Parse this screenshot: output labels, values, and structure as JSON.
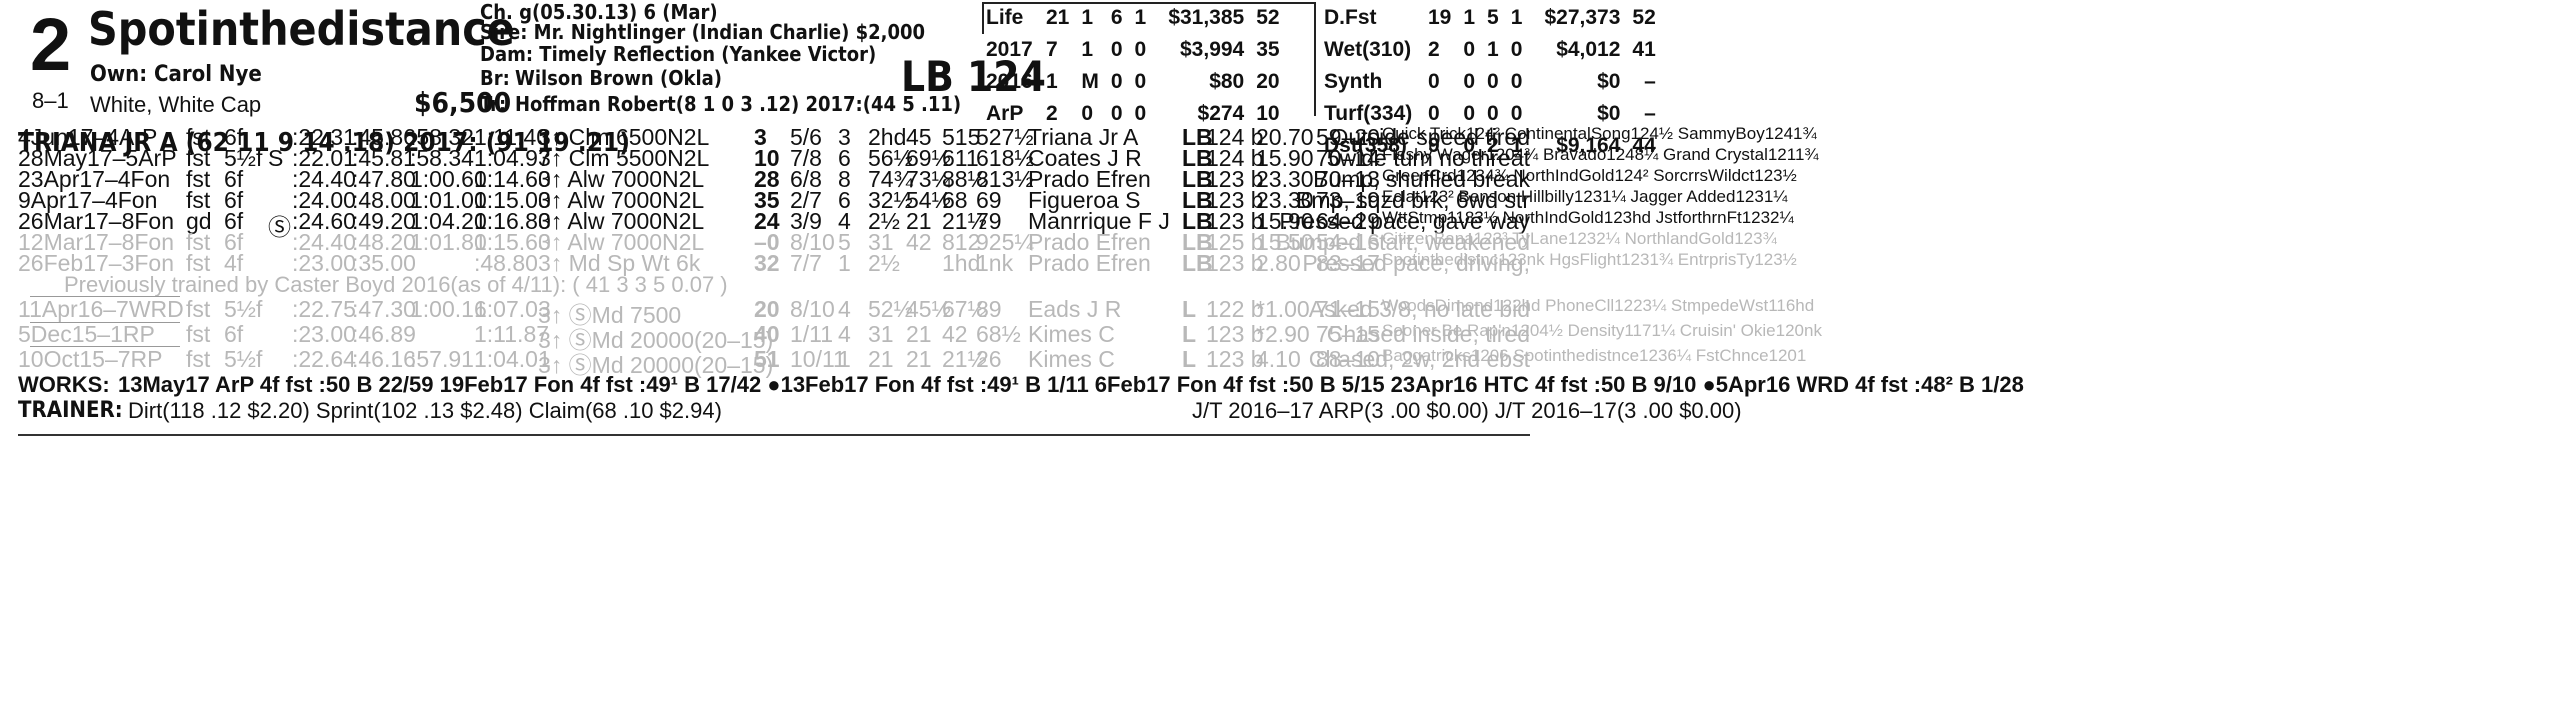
{
  "header": {
    "post_position": "2",
    "horse_name": "Spotinthedistance",
    "morning_line": "8–1",
    "owner": "Own: Carol Nye",
    "silks": "White, White Cap",
    "claim_price": "$6,500",
    "jockey_line": "TRIANA JR A (62 11 9 14 .18) 2017: (91 19 .21)",
    "sex_age": "Ch. g(05.30.13) 6 (Mar)",
    "sire": "Sire: Mr. Nightlinger (Indian Charlie) $2,000",
    "dam": "Dam: Timely Reflection (Yankee Victor)",
    "breeder_label": "Br:",
    "breeder": "Wilson Brown (Okla)",
    "trainer_label": "Tr:",
    "trainer": "Hoffman Robert(8 1 0 3 .12) 2017:(44 5 .11)",
    "weight": "LB 124"
  },
  "record_left": [
    [
      "Life",
      "21",
      "1",
      "6",
      "1",
      "$31,385",
      "52"
    ],
    [
      "2017",
      "7",
      "1",
      "0",
      "0",
      "$3,994",
      "35"
    ],
    [
      "2016",
      "1",
      "M",
      "0",
      "0",
      "$80",
      "20"
    ],
    [
      "ArP",
      "2",
      "0",
      "0",
      "0",
      "$274",
      "10"
    ]
  ],
  "record_right": [
    [
      "D.Fst",
      "19",
      "1",
      "5",
      "1",
      "$27,373",
      "52"
    ],
    [
      "Wet(310)",
      "2",
      "0",
      "1",
      "0",
      "$4,012",
      "41"
    ],
    [
      "Synth",
      "0",
      "0",
      "0",
      "0",
      "$0",
      "–"
    ],
    [
      "Turf(334)",
      "0",
      "0",
      "0",
      "0",
      "$0",
      "–"
    ],
    [
      "Dst(358)",
      "9",
      "0",
      "2",
      "1",
      "$9,164",
      "44"
    ]
  ],
  "past_performances": [
    {
      "date": "4Jun17–4ArP",
      "cond": "fst",
      "dist": "6f",
      "mark": "",
      "fr1": ":22.31",
      "fr2": ":45.86",
      "fr3": ":58.32",
      "fin": "1:11.40",
      "race": "3↑ Clm 6500N2L",
      "bsf": "3",
      "pp": "5/6",
      "st": "3",
      "c1": "2hd",
      "c2": "45",
      "str": "515",
      "finpos": "527½",
      "jockey": "Triana Jr A",
      "med": "LB",
      "wt": "124 b",
      "odds": "20.70",
      "figs": "59–20",
      "top3": "Quick Trick124² ContinentalSong124½ SammyBoy1241¾",
      "comment": "Outside speed tired",
      "faded": false
    },
    {
      "date": "28May17–5ArP",
      "cond": "fst",
      "dist": "5½f",
      "mark": "S",
      "fr1": ":22.01",
      "fr2": ":45.81",
      "fr3": ":58.34",
      "fin": "1:04.97",
      "race": "3↑ Clm 5500N2L",
      "bsf": "10",
      "pp": "7/8",
      "st": "6",
      "c1": "56½",
      "c2": "69½",
      "str": "611",
      "finpos": "618½",
      "jockey": "Coates J R",
      "med": "LB",
      "wt": "124 b",
      "odds": "15.90",
      "figs": "70–14",
      "top3": "Flashy Wager1204¾ Bravado1248¼ Grand Crystal1211¾",
      "comment": "5wide turn no threat",
      "faded": false
    },
    {
      "date": "23Apr17–4Fon",
      "cond": "fst",
      "dist": "6f",
      "mark": "",
      "fr1": ":24.40",
      "fr2": ":47.80",
      "fr3": "1:00.60",
      "fin": "1:14.60",
      "race": "3↑ Alw 7000N2L",
      "bsf": "28",
      "pp": "6/8",
      "st": "8",
      "c1": "74¾",
      "c2": "73¼",
      "str": "88½",
      "finpos": "813½",
      "jockey": "Prado Efren",
      "med": "LB",
      "wt": "123 b",
      "odds": "23.30",
      "figs": "70–13",
      "top3": "GreenCrd1234¾ NorthIndGold124² SorcrrsWildct123½",
      "comment": "Bump, shuffled break",
      "faded": false
    },
    {
      "date": "9Apr17–4Fon",
      "cond": "fst",
      "dist": "6f",
      "mark": "",
      "fr1": ":24.00",
      "fr2": ":48.00",
      "fr3": "1:01.00",
      "fin": "1:15.00",
      "race": "3↑ Alw 7000N2L",
      "bsf": "35",
      "pp": "2/7",
      "st": "6",
      "c1": "32½",
      "c2": "54½",
      "str": "68",
      "finpos": "69",
      "jockey": "Figueroa S",
      "med": "LB",
      "wt": "123 b",
      "odds": "23.30",
      "figs": "73–19",
      "top3": "Eclat123² Benson Hillbilly1231¼ Jagger Added1231¼",
      "comment": "Bmp, sqzd brk, 6wd str",
      "faded": false
    },
    {
      "date": "26Mar17–8Fon",
      "cond": "gd",
      "dist": "6f",
      "mark": "Ⓢ",
      "fr1": ":24.60",
      "fr2": ":49.20",
      "fr3": "1:04.20",
      "fin": "1:16.80",
      "race": "3↑ Alw 7000N2L",
      "bsf": "24",
      "pp": "3/9",
      "st": "4",
      "c1": "2½",
      "c2": "21",
      "str": "21½",
      "finpos": "79",
      "jockey": "Manrrique F J",
      "med": "LB",
      "wt": "123 b",
      "odds": "15.90",
      "figs": "64–29",
      "top3": "WttStmp1183½ NorthIndGold123hd JstforthrnFt1232¼",
      "comment": "Pressed pace, gave way",
      "faded": false
    },
    {
      "date": "12Mar17–8Fon",
      "cond": "fst",
      "dist": "6f",
      "mark": "",
      "fr1": ":24.40",
      "fr2": ":48.20",
      "fr3": "1:01.80",
      "fin": "1:15.60",
      "race": "3↑ Alw 7000N2L",
      "bsf": "–0",
      "pp": "8/10",
      "st": "5",
      "c1": "31",
      "c2": "42",
      "str": "812",
      "finpos": "925¼",
      "jockey": "Prado Efren",
      "med": "LB",
      "wt": "125 b",
      "odds": "15.50",
      "figs": "54–16",
      "top3": "CitizenBana123³ TyLane1232¼ NorthlandGold123¾",
      "comment": "Bumped start, weakened",
      "faded": true
    },
    {
      "date": "26Feb17–3Fon",
      "cond": "fst",
      "dist": "4f",
      "mark": "",
      "fr1": ":23.00",
      "fr2": ":35.00",
      "fr3": "",
      "fin": ":48.80",
      "race": "3↑ Md Sp Wt 6k",
      "bsf": "32",
      "pp": "7/7",
      "st": "1",
      "c1": "2½",
      "c2": "",
      "str": "1hd",
      "finpos": "1nk",
      "jockey": "Prado Efren",
      "med": "LB",
      "wt": "123 b",
      "odds": "2.80",
      "figs": "83–17",
      "top3": "Spotinthedistnc123nk HgsFlight1231¾ EntrprisTy123½",
      "comment": "Pressed pace, driving,",
      "faded": true
    }
  ],
  "previous_trainer_note": "Previously trained by Caster Boyd 2016(as of 4/11): ( 41 3 3 5 0.07 )",
  "older_performances": [
    {
      "date": "11Apr16–7WRD",
      "cond": "fst",
      "dist": "5½f",
      "mark": "",
      "fr1": ":22.75",
      "fr2": ":47.30",
      "fr3": "1:00.16",
      "fin": "1:07.03",
      "race": "3↑ ⓈMd 7500",
      "bsf": "20",
      "pp": "8/10",
      "st": "4",
      "c1": "52½",
      "c2": "45½",
      "str": "67½",
      "finpos": "89",
      "jockey": "Eads J R",
      "med": "L",
      "wt": "122 b",
      "odds": "*1.00",
      "figs": "71–15",
      "top3": "WoodsDimond122hd PhoneCll1223¼ StmpedeWst116hd",
      "comment": "Asked 3/8, no late bid"
    },
    {
      "date": "5Dec15–1RP",
      "cond": "fst",
      "dist": "6f",
      "mark": "",
      "fr1": ":23.00",
      "fr2": ":46.89",
      "fr3": "",
      "fin": "1:11.87",
      "race": "3↑ ⓈMd 20000(20–15)",
      "bsf": "40",
      "pp": "1/11",
      "st": "4",
      "c1": "31",
      "c2": "21",
      "str": "42",
      "finpos": "68½",
      "jockey": "Kimes C",
      "med": "L",
      "wt": "123 b",
      "odds": "*2.90",
      "figs": "75–15",
      "top3": "Sooner Be Rap'n1204½ Density1171¼ Cruisin' Okie120nk",
      "comment": "Chased inside, tired"
    },
    {
      "date": "10Oct15–7RP",
      "cond": "fst",
      "dist": "5½f",
      "mark": "",
      "fr1": ":22.64",
      "fr2": ":46.16",
      "fr3": ":57.91",
      "fin": "1:04.01",
      "race": "3↑ ⓈMd 20000(20–15)",
      "bsf": "51",
      "pp": "10/11",
      "st": "1",
      "c1": "21",
      "c2": "21",
      "str": "21½",
      "finpos": "26",
      "jockey": "Kimes C",
      "med": "L",
      "wt": "123 b",
      "odds": "4.10",
      "figs": "88–10",
      "top3": "Baggatricks1206 Spotinthedistnce1236¼ FstChnce1201",
      "comment": "Chased, 2w, 2nd ebst"
    }
  ],
  "works": {
    "label": "WORKS:",
    "text": "13May17 ArP 4f fst :50 B 22/59   19Feb17 Fon 4f fst :49¹ B 17/42   ●13Feb17 Fon 4f fst :49¹ B 1/11   6Feb17 Fon 4f fst :50 B 5/15   23Apr16 HTC 4f fst :50 B 9/10   ●5Apr16 WRD 4f fst :48² B 1/28"
  },
  "trainer_stats": {
    "label": "TRAINER:",
    "text": "Dirt(118 .12 $2.20) Sprint(102 .13 $2.48) Claim(68 .10 $2.94)",
    "jt": "J/T 2016–17 ARP(3 .00 $0.00)  J/T 2016–17(3 .00 $0.00)"
  }
}
